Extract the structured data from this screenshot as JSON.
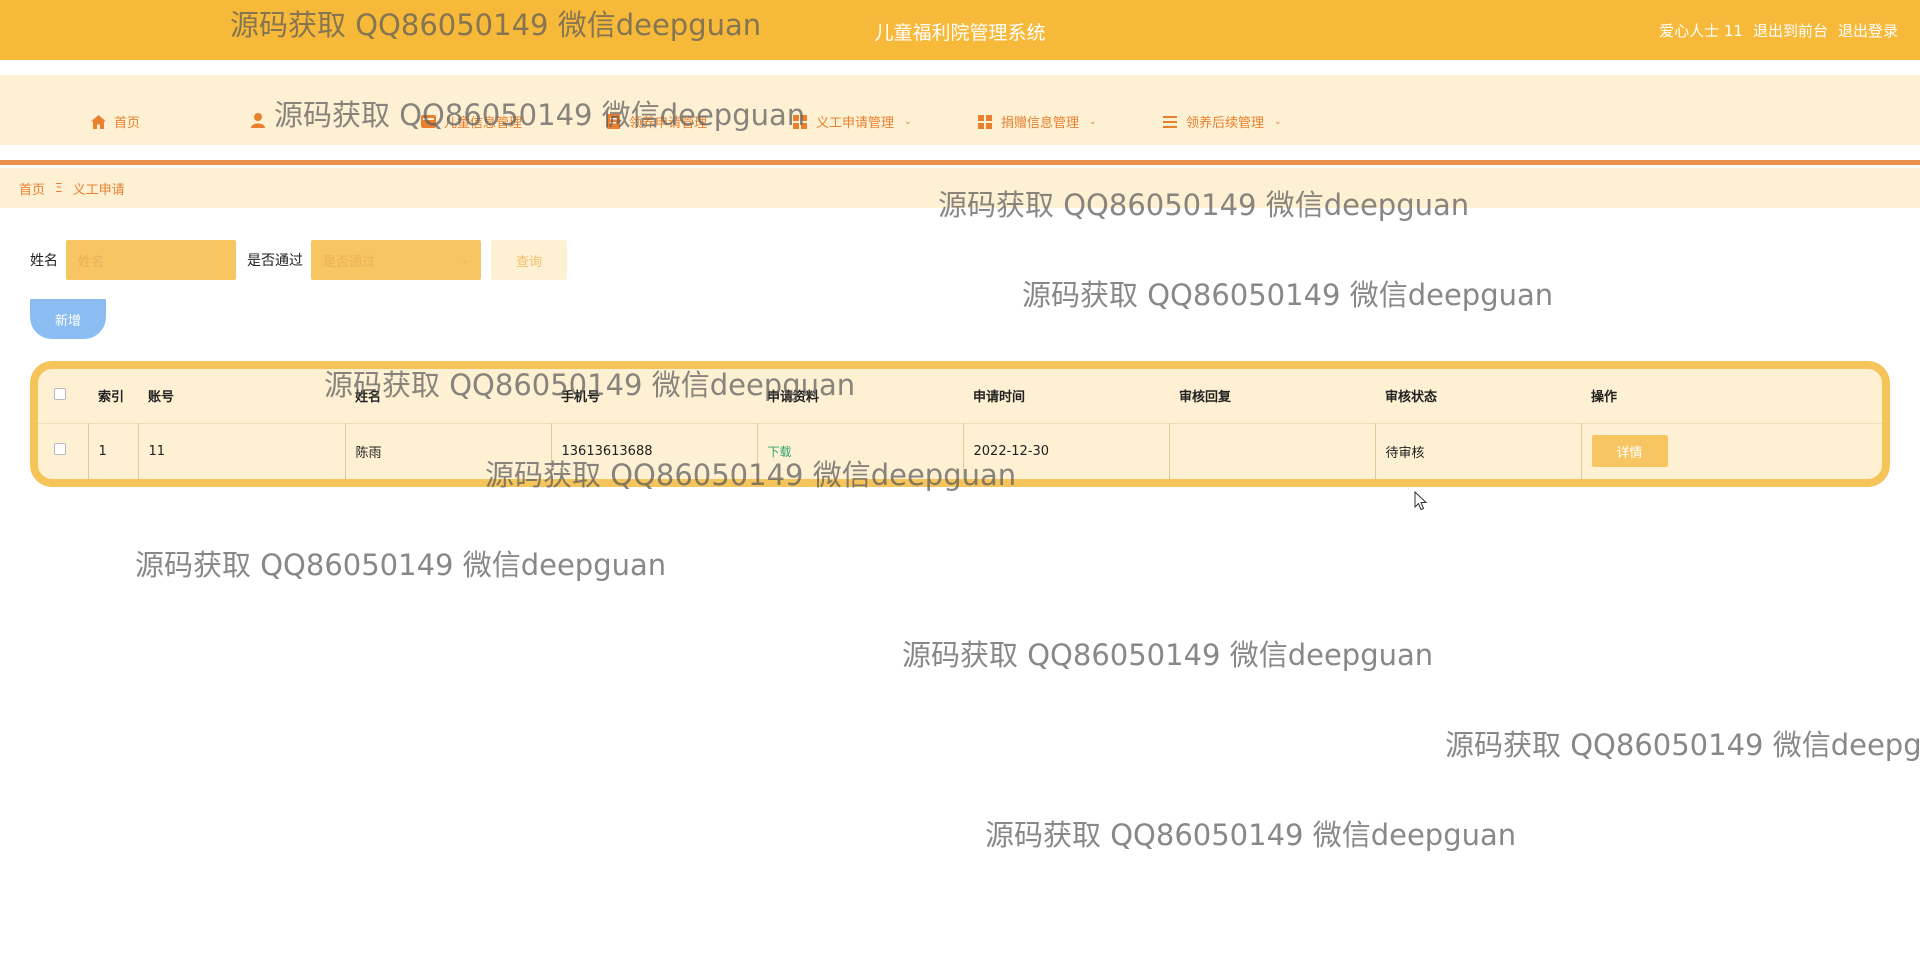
{
  "header": {
    "app_title": "儿童福利院管理系统",
    "user_label": "爱心人士 11",
    "to_front_label": "退出到前台",
    "logout_label": "退出登录"
  },
  "nav": {
    "items": [
      {
        "label": "首页",
        "icon": "home-icon",
        "has_dropdown": false
      },
      {
        "label": "",
        "icon": "user-icon",
        "has_dropdown": false
      },
      {
        "label": "儿童信息管理",
        "icon": "card-icon",
        "has_dropdown": false
      },
      {
        "label": "领养申请管理",
        "icon": "doc-icon",
        "has_dropdown": false
      },
      {
        "label": "义工申请管理",
        "icon": "grid-icon",
        "has_dropdown": true
      },
      {
        "label": "捐赠信息管理",
        "icon": "grid-icon",
        "has_dropdown": true
      },
      {
        "label": "领养后续管理",
        "icon": "list-icon",
        "has_dropdown": true
      }
    ]
  },
  "breadcrumb": {
    "home": "首页",
    "separator": "Ξ",
    "current": "义工申请"
  },
  "search": {
    "name_label": "姓名",
    "name_placeholder": "姓名",
    "pass_label": "是否通过",
    "pass_placeholder": "是否通过",
    "query_label": "查询"
  },
  "actions": {
    "add_label": "新增"
  },
  "table": {
    "headers": [
      "索引",
      "账号",
      "姓名",
      "手机号",
      "申请资料",
      "申请时间",
      "审核回复",
      "审核状态",
      "操作"
    ],
    "rows": [
      {
        "index": "1",
        "account": "11",
        "name": "陈雨",
        "phone": "13613613688",
        "material": "下载",
        "time": "2022-12-30",
        "reply": "",
        "status": "待审核",
        "action": "详情"
      }
    ]
  },
  "watermark": "源码获取 QQ86050149 微信deepguan",
  "colors": {
    "topbar": "#f7b93a",
    "nav_bg": "#fdf0d3",
    "accent": "#e8802f",
    "add_button": "#8bbdf3",
    "table_border": "#f5c55c"
  }
}
